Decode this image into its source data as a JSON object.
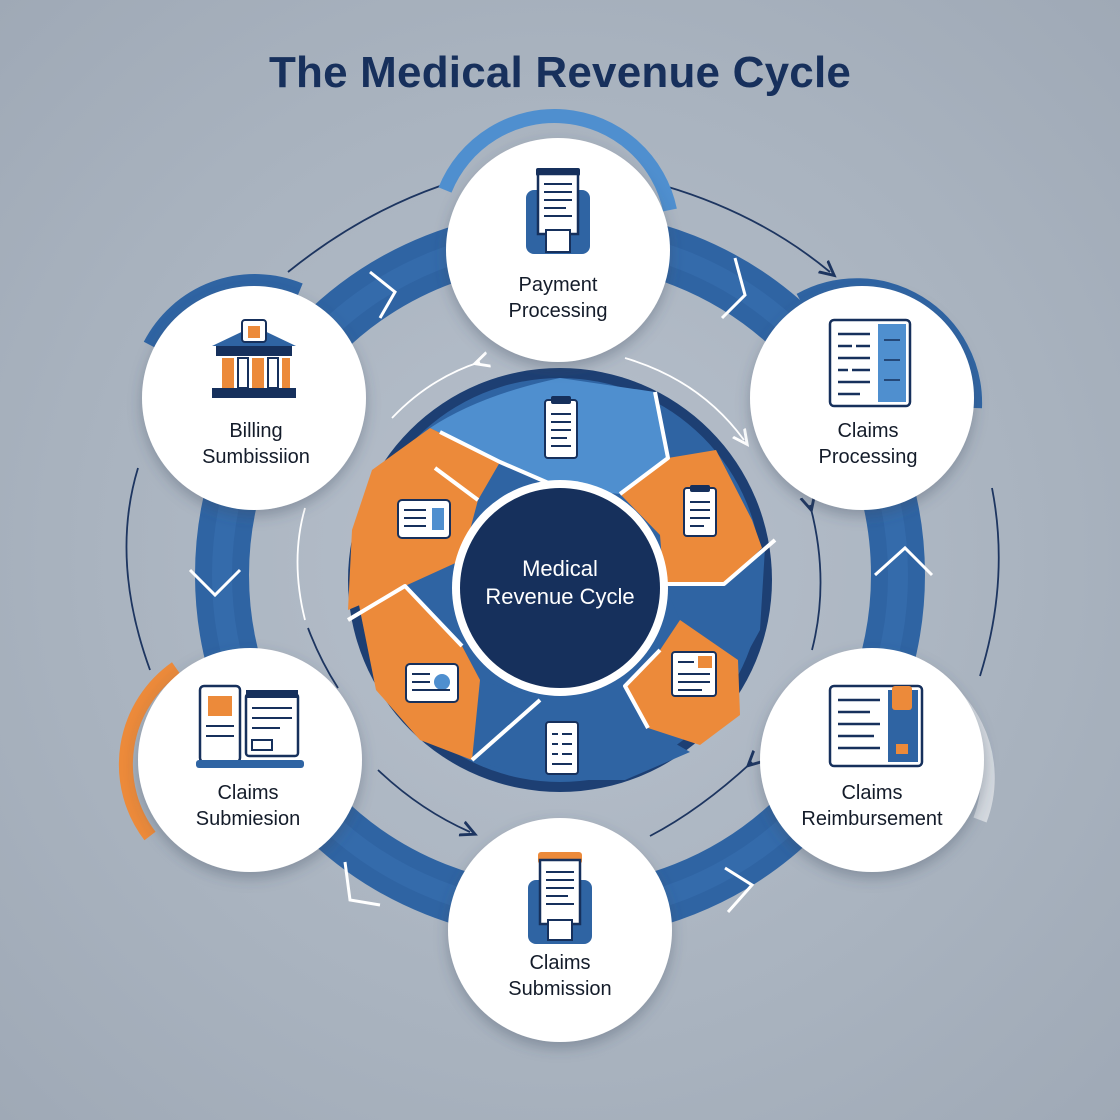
{
  "title": "The Medical Revenue Cycle",
  "center": {
    "line1": "Medical",
    "line2": "Revenue Cycle"
  },
  "nodes": [
    {
      "line1": "Payment",
      "line2": "Processing",
      "icon": "document-on-tray-icon"
    },
    {
      "line1": "Claims",
      "line2": "Processing",
      "icon": "claims-form-icon"
    },
    {
      "line1": "Claims",
      "line2": "Reimbursement",
      "icon": "ledger-book-icon"
    },
    {
      "line1": "Claims",
      "line2": "Submission",
      "icon": "clipboard-on-tray-icon"
    },
    {
      "line1": "Claims",
      "line2": "Submiesion",
      "icon": "devices-forms-icon"
    },
    {
      "line1": "Billing",
      "line2": "Sumbissiion",
      "icon": "bank-building-icon"
    }
  ],
  "colors": {
    "navy": "#16305c",
    "blue": "#2f64a3",
    "light_blue": "#4f8fcf",
    "orange": "#ec8a3a",
    "white": "#ffffff"
  }
}
